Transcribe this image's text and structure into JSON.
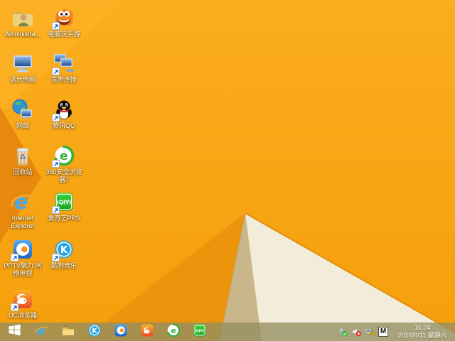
{
  "desktop": {
    "icons": [
      {
        "id": "administrator-folder",
        "label": "Administra...",
        "shortcut": false
      },
      {
        "id": "pc-play-mobile-games",
        "label": "电脑玩手游",
        "shortcut": true
      },
      {
        "id": "this-pc",
        "label": "这台电脑",
        "shortcut": false
      },
      {
        "id": "broadband-connection",
        "label": "宽带连接",
        "shortcut": true
      },
      {
        "id": "network",
        "label": "网络",
        "shortcut": false
      },
      {
        "id": "tencent-qq",
        "label": "腾讯QQ",
        "shortcut": true
      },
      {
        "id": "recycle-bin",
        "label": "回收站",
        "shortcut": false
      },
      {
        "id": "360-safe-browser",
        "label": "360安全浏览器7",
        "shortcut": true
      },
      {
        "id": "internet-explorer",
        "label": "Internet Explorer",
        "shortcut": false
      },
      {
        "id": "iqiyi-pps",
        "label": "爱奇艺PPS",
        "shortcut": true
      },
      {
        "id": "pptv",
        "label": "PPTV聚力 网络电视",
        "shortcut": true
      },
      {
        "id": "kugou-music",
        "label": "酷狗音乐",
        "shortcut": true
      },
      {
        "id": "uc-browser",
        "label": "UC浏览器",
        "shortcut": true
      }
    ]
  },
  "taskbar": {
    "buttons": [
      {
        "id": "start-button"
      },
      {
        "id": "internet-explorer"
      },
      {
        "id": "file-explorer"
      },
      {
        "id": "kugou-music"
      },
      {
        "id": "pptv"
      },
      {
        "id": "uc-browser"
      },
      {
        "id": "360-safe-browser"
      },
      {
        "id": "iqiyi-pps"
      }
    ],
    "tray": {
      "icons": [
        "hardware-safely-remove",
        "volume-muted",
        "network-warning",
        "ime-mode"
      ],
      "ime_label": "M",
      "clock": {
        "time": "15:24",
        "date": "2016/6/11 星期六"
      }
    }
  },
  "wallpaper": {
    "colors": {
      "base_top": "#fbad1d",
      "base_bottom": "#f59f0c",
      "dark_wedge": "#e7890d",
      "facet": "#ec940c",
      "tan_facet": "#c9b68a",
      "white_facet": "#f2ecdb",
      "edge_line": "#e18e06",
      "taskbar_tint": "#a9924e"
    }
  }
}
